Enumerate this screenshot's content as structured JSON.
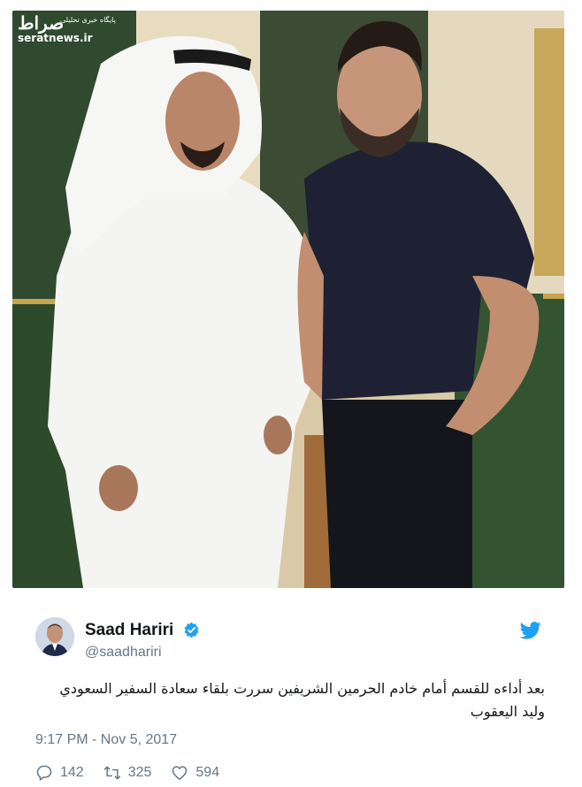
{
  "watermark": {
    "logo": "صراط",
    "tagline": "پایگاه خبری تحلیلی",
    "site": "seratnews.ir"
  },
  "photo": {
    "alt_subject": "two-men-standing-photo"
  },
  "tweet": {
    "author_name": "Saad Hariri",
    "handle": "@saadhariri",
    "verified_icon": "verified-badge-icon",
    "platform_icon": "twitter-bird-icon",
    "text": "بعد أداءه للقسم أمام خادم الحرمين الشريفين سررت بلقاء سعادة السفير السعودي وليد اليعقوب",
    "timestamp": "9:17 PM - Nov 5, 2017",
    "actions": {
      "reply_count": "142",
      "retweet_count": "325",
      "like_count": "594"
    }
  },
  "colors": {
    "accent": "#1da1f2",
    "muted": "#657786",
    "text": "#14171a"
  }
}
